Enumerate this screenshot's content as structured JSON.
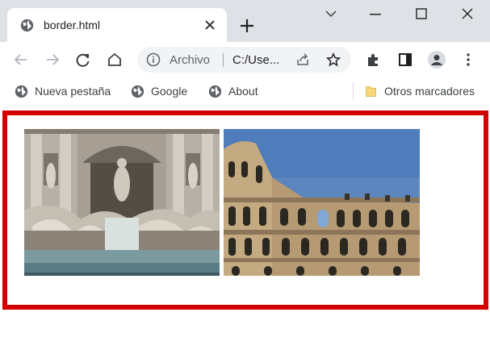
{
  "browser": {
    "tab": {
      "title": "border.html",
      "icon": "globe-icon"
    },
    "new_tab_icon": "plus-icon",
    "window_controls": [
      "chevron-down-icon",
      "minimize-icon",
      "maximize-icon",
      "close-icon"
    ]
  },
  "toolbar": {
    "back_icon": "back-arrow-icon",
    "forward_icon": "forward-arrow-icon",
    "reload_icon": "reload-icon",
    "home_icon": "home-icon",
    "address": {
      "scheme_label": "Archivo",
      "url_text": "C:/Use..."
    },
    "share_icon": "share-icon",
    "bookmark_star_icon": "star-icon",
    "extensions_icon": "puzzle-icon",
    "side_panel_icon": "side-panel-icon",
    "profile_icon": "avatar-icon",
    "menu_icon": "three-dots-icon"
  },
  "bookmarks": {
    "items": [
      {
        "label": "Nueva pestaña",
        "icon": "globe-icon"
      },
      {
        "label": "Google",
        "icon": "globe-icon"
      },
      {
        "label": "About",
        "icon": "globe-icon"
      }
    ],
    "other": {
      "label": "Otros marcadores",
      "icon": "folder-icon"
    }
  },
  "page": {
    "border_color": "#d40000",
    "images": [
      {
        "subject": "trevi-fountain"
      },
      {
        "subject": "colosseum"
      }
    ]
  }
}
